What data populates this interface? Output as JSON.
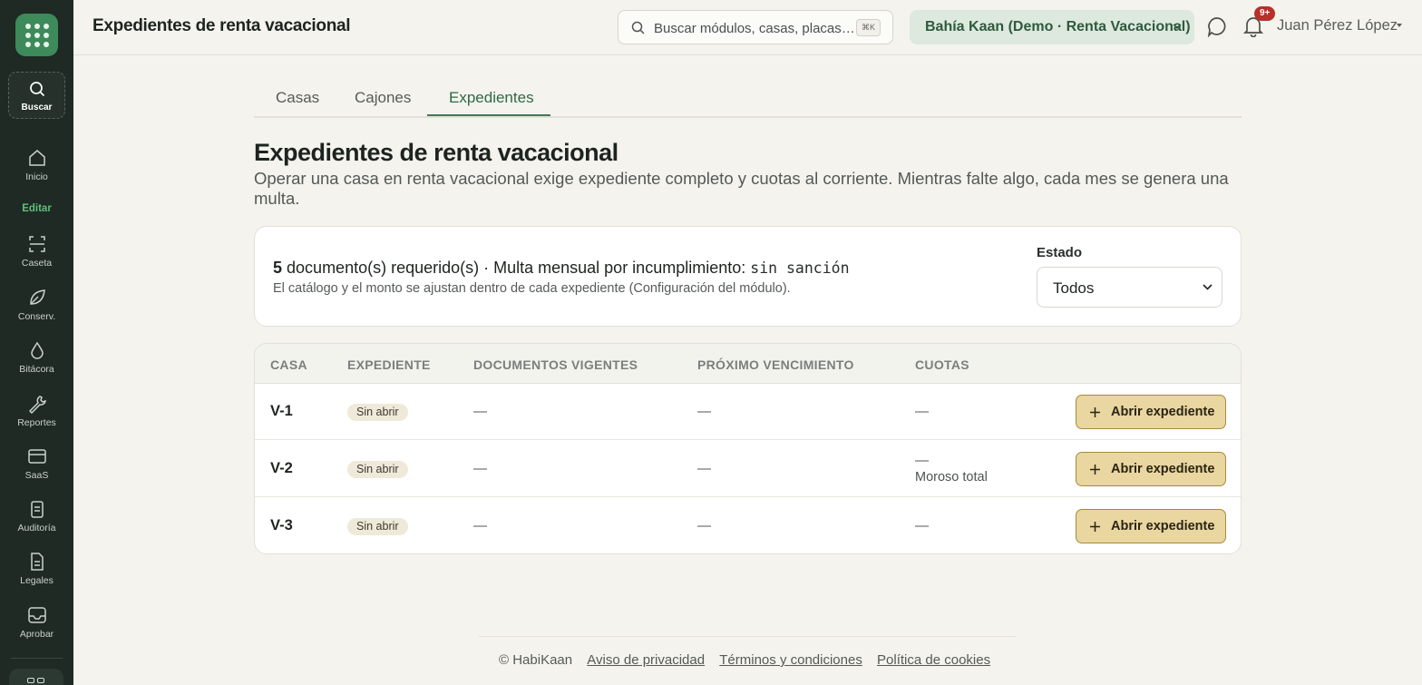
{
  "sidebar": {
    "search_label": "Buscar",
    "section_label": "Editar",
    "items": [
      {
        "label": "Inicio",
        "icon": "home-icon"
      },
      {
        "label": "Caseta",
        "icon": "scan-icon"
      },
      {
        "label": "Conserv.",
        "icon": "leaf-icon"
      },
      {
        "label": "Bitácora",
        "icon": "drop-icon"
      },
      {
        "label": "Reportes",
        "icon": "wrench-icon"
      },
      {
        "label": "SaaS",
        "icon": "card-icon"
      },
      {
        "label": "Auditoría",
        "icon": "clipboard-icon"
      },
      {
        "label": "Legales",
        "icon": "document-icon"
      },
      {
        "label": "Aprobar",
        "icon": "inbox-icon"
      }
    ]
  },
  "header": {
    "title": "Expedientes de renta vacacional",
    "search_placeholder": "Buscar módulos, casas, placas…",
    "search_shortcut": "⌘K",
    "org": "Bahía Kaan (Demo · Renta Vacacional)",
    "notifications_badge": "9+",
    "user": "Juan Pérez López"
  },
  "tabs": [
    {
      "label": "Casas",
      "active": false
    },
    {
      "label": "Cajones",
      "active": false
    },
    {
      "label": "Expedientes",
      "active": true
    }
  ],
  "page": {
    "heading": "Expedientes de renta vacacional",
    "subtitle": "Operar una casa en renta vacacional exige expediente completo y cuotas al corriente. Mientras falte algo, cada mes se genera una multa."
  },
  "summary": {
    "count": "5",
    "text": "documento(s) requerido(s) · Multa mensual por incumplimiento:",
    "sanction": "sin sanción",
    "note": "El catálogo y el monto se ajustan dentro de cada expediente (Configuración del módulo).",
    "filter_label": "Estado",
    "filter_value": "Todos"
  },
  "table": {
    "columns": [
      "CASA",
      "EXPEDIENTE",
      "DOCUMENTOS VIGENTES",
      "PRÓXIMO VENCIMIENTO",
      "CUOTAS"
    ],
    "rows": [
      {
        "casa": "V-1",
        "expediente": "Sin abrir",
        "documentos": "—",
        "vencimiento": "—",
        "cuotas": "—",
        "cuotas_note": "",
        "action": "Abrir expediente"
      },
      {
        "casa": "V-2",
        "expediente": "Sin abrir",
        "documentos": "—",
        "vencimiento": "—",
        "cuotas": "—",
        "cuotas_note": "Moroso total",
        "action": "Abrir expediente"
      },
      {
        "casa": "V-3",
        "expediente": "Sin abrir",
        "documentos": "—",
        "vencimiento": "—",
        "cuotas": "—",
        "cuotas_note": "",
        "action": "Abrir expediente"
      }
    ]
  },
  "footer": {
    "copyright": "© HabiKaan",
    "links": [
      "Aviso de privacidad",
      "Términos y condiciones",
      "Política de cookies"
    ]
  },
  "colors": {
    "sidebar_bg": "#1f2a24",
    "accent_green": "#3e7a52",
    "button_gold": "#e9d6a0",
    "badge_red": "#b7312c"
  }
}
